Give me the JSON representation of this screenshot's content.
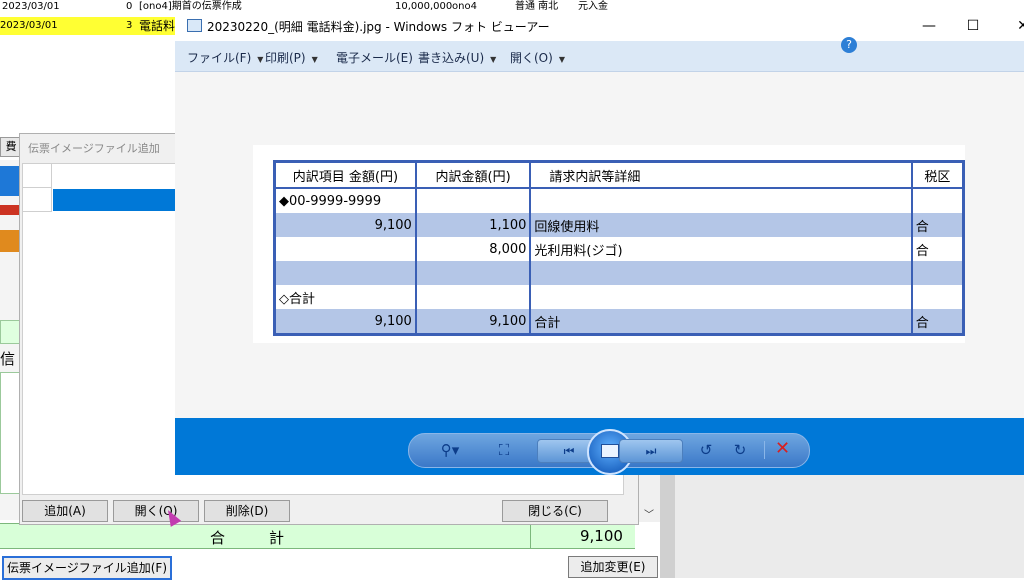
{
  "background": {
    "row1": {
      "date": "2023/03/01",
      "count": "0",
      "desc": "[ono4]期首の伝票作成",
      "amount": "10,000,000",
      "code": "ono4",
      "tag": "普通 南北",
      "extra": "元入金"
    },
    "row2": {
      "date": "2023/03/01",
      "count": "3",
      "desc": "電話料"
    },
    "tab_label": "費",
    "side_char": "信",
    "total_label": "合計",
    "total_value": "9,100",
    "add_image_button": "伝票イメージファイル追加(F)",
    "add_change_button": "追加変更(E)"
  },
  "dialog": {
    "title": "伝票イメージファイル追加",
    "buttons": {
      "add": "追加(A)",
      "open": "開く(O)",
      "delete": "削除(D)",
      "close": "閉じる(C)"
    }
  },
  "photo_viewer": {
    "title": "20230220_(明細 電話料金).jpg - Windows フォト ビューアー",
    "controls": {
      "minimize": "—",
      "maximize": "☐",
      "close": "✕"
    },
    "menu": [
      {
        "label": "ファイル(F)",
        "dropdown": true
      },
      {
        "label": "印刷(P)",
        "dropdown": true
      },
      {
        "label": "電子メール(E)",
        "dropdown": false
      },
      {
        "label": "書き込み(U)",
        "dropdown": true
      },
      {
        "label": "開く(O)",
        "dropdown": true
      }
    ],
    "invoice": {
      "headers": [
        "内訳項目 金額(円)",
        "内訳金額(円)",
        "請求内訳等詳細",
        "税区"
      ],
      "rows": [
        [
          "◆00-9999-9999",
          "",
          "",
          ""
        ],
        [
          "9,100",
          "1,100",
          "回線使用料",
          "合"
        ],
        [
          "",
          "8,000",
          "光利用料(ジゴ)",
          "合"
        ],
        [
          "",
          "",
          "",
          ""
        ],
        [
          "◇合計",
          "",
          "",
          ""
        ],
        [
          "9,100",
          "9,100",
          "合計",
          "合"
        ]
      ]
    },
    "toolbar": {
      "icons": [
        "zoom-icon",
        "fit-window-icon",
        "previous-icon",
        "slideshow-icon",
        "next-icon",
        "rotate-left-icon",
        "rotate-right-icon",
        "delete-icon"
      ]
    }
  }
}
